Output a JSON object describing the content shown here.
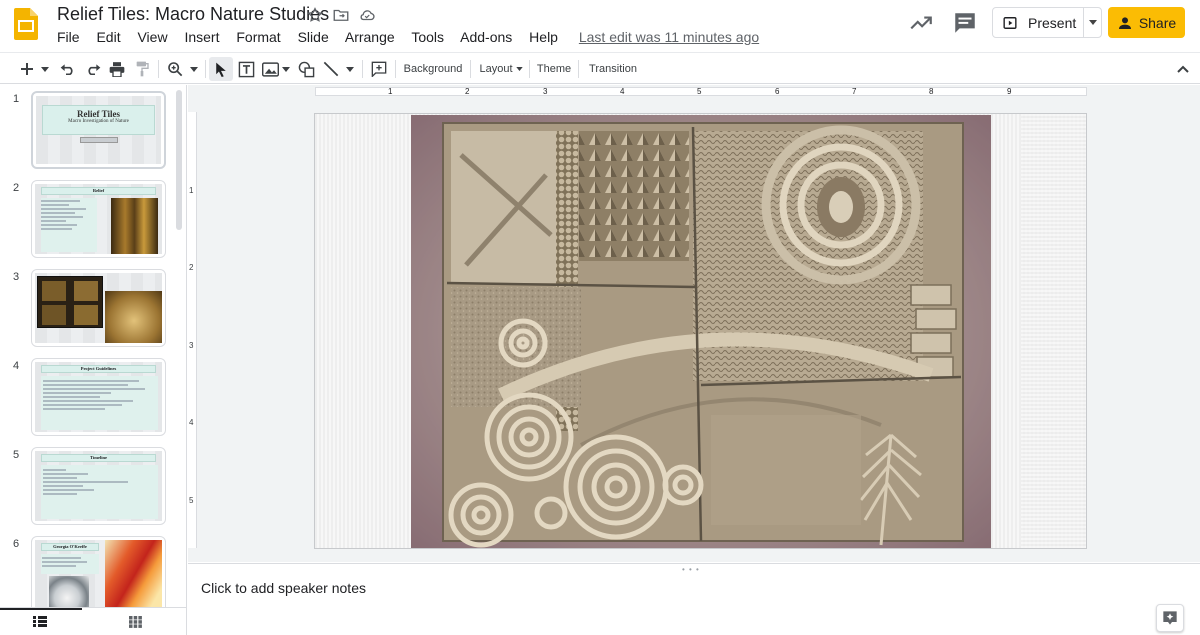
{
  "app": {
    "doc_title": "Relief Tiles: Macro Nature Studies",
    "brand_color": "#f4b400",
    "share_color": "#fbbc04"
  },
  "menu": {
    "items": [
      "File",
      "Edit",
      "View",
      "Insert",
      "Format",
      "Slide",
      "Arrange",
      "Tools",
      "Add-ons",
      "Help"
    ],
    "last_edit": "Last edit was 11 minutes ago"
  },
  "header_buttons": {
    "present": "Present",
    "share": "Share"
  },
  "toolbar": {
    "background": "Background",
    "layout": "Layout",
    "theme": "Theme",
    "transition": "Transition"
  },
  "ruler": {
    "h_ticks": [
      "1",
      "2",
      "3",
      "4",
      "5",
      "6",
      "7",
      "8",
      "9"
    ],
    "v_ticks": [
      "1",
      "2",
      "3",
      "4",
      "5"
    ]
  },
  "filmstrip": {
    "slides": [
      {
        "num": "1",
        "title": "Relief Tiles",
        "subtitle": "Macro Investigation of Nature"
      },
      {
        "num": "2",
        "title": "Relief"
      },
      {
        "num": "3"
      },
      {
        "num": "4",
        "title": "Project Guidelines"
      },
      {
        "num": "5",
        "title": "Timeline"
      },
      {
        "num": "6",
        "title": "Georgia O'Keeffe"
      }
    ]
  },
  "notes": {
    "placeholder": "Click to add speaker notes"
  }
}
